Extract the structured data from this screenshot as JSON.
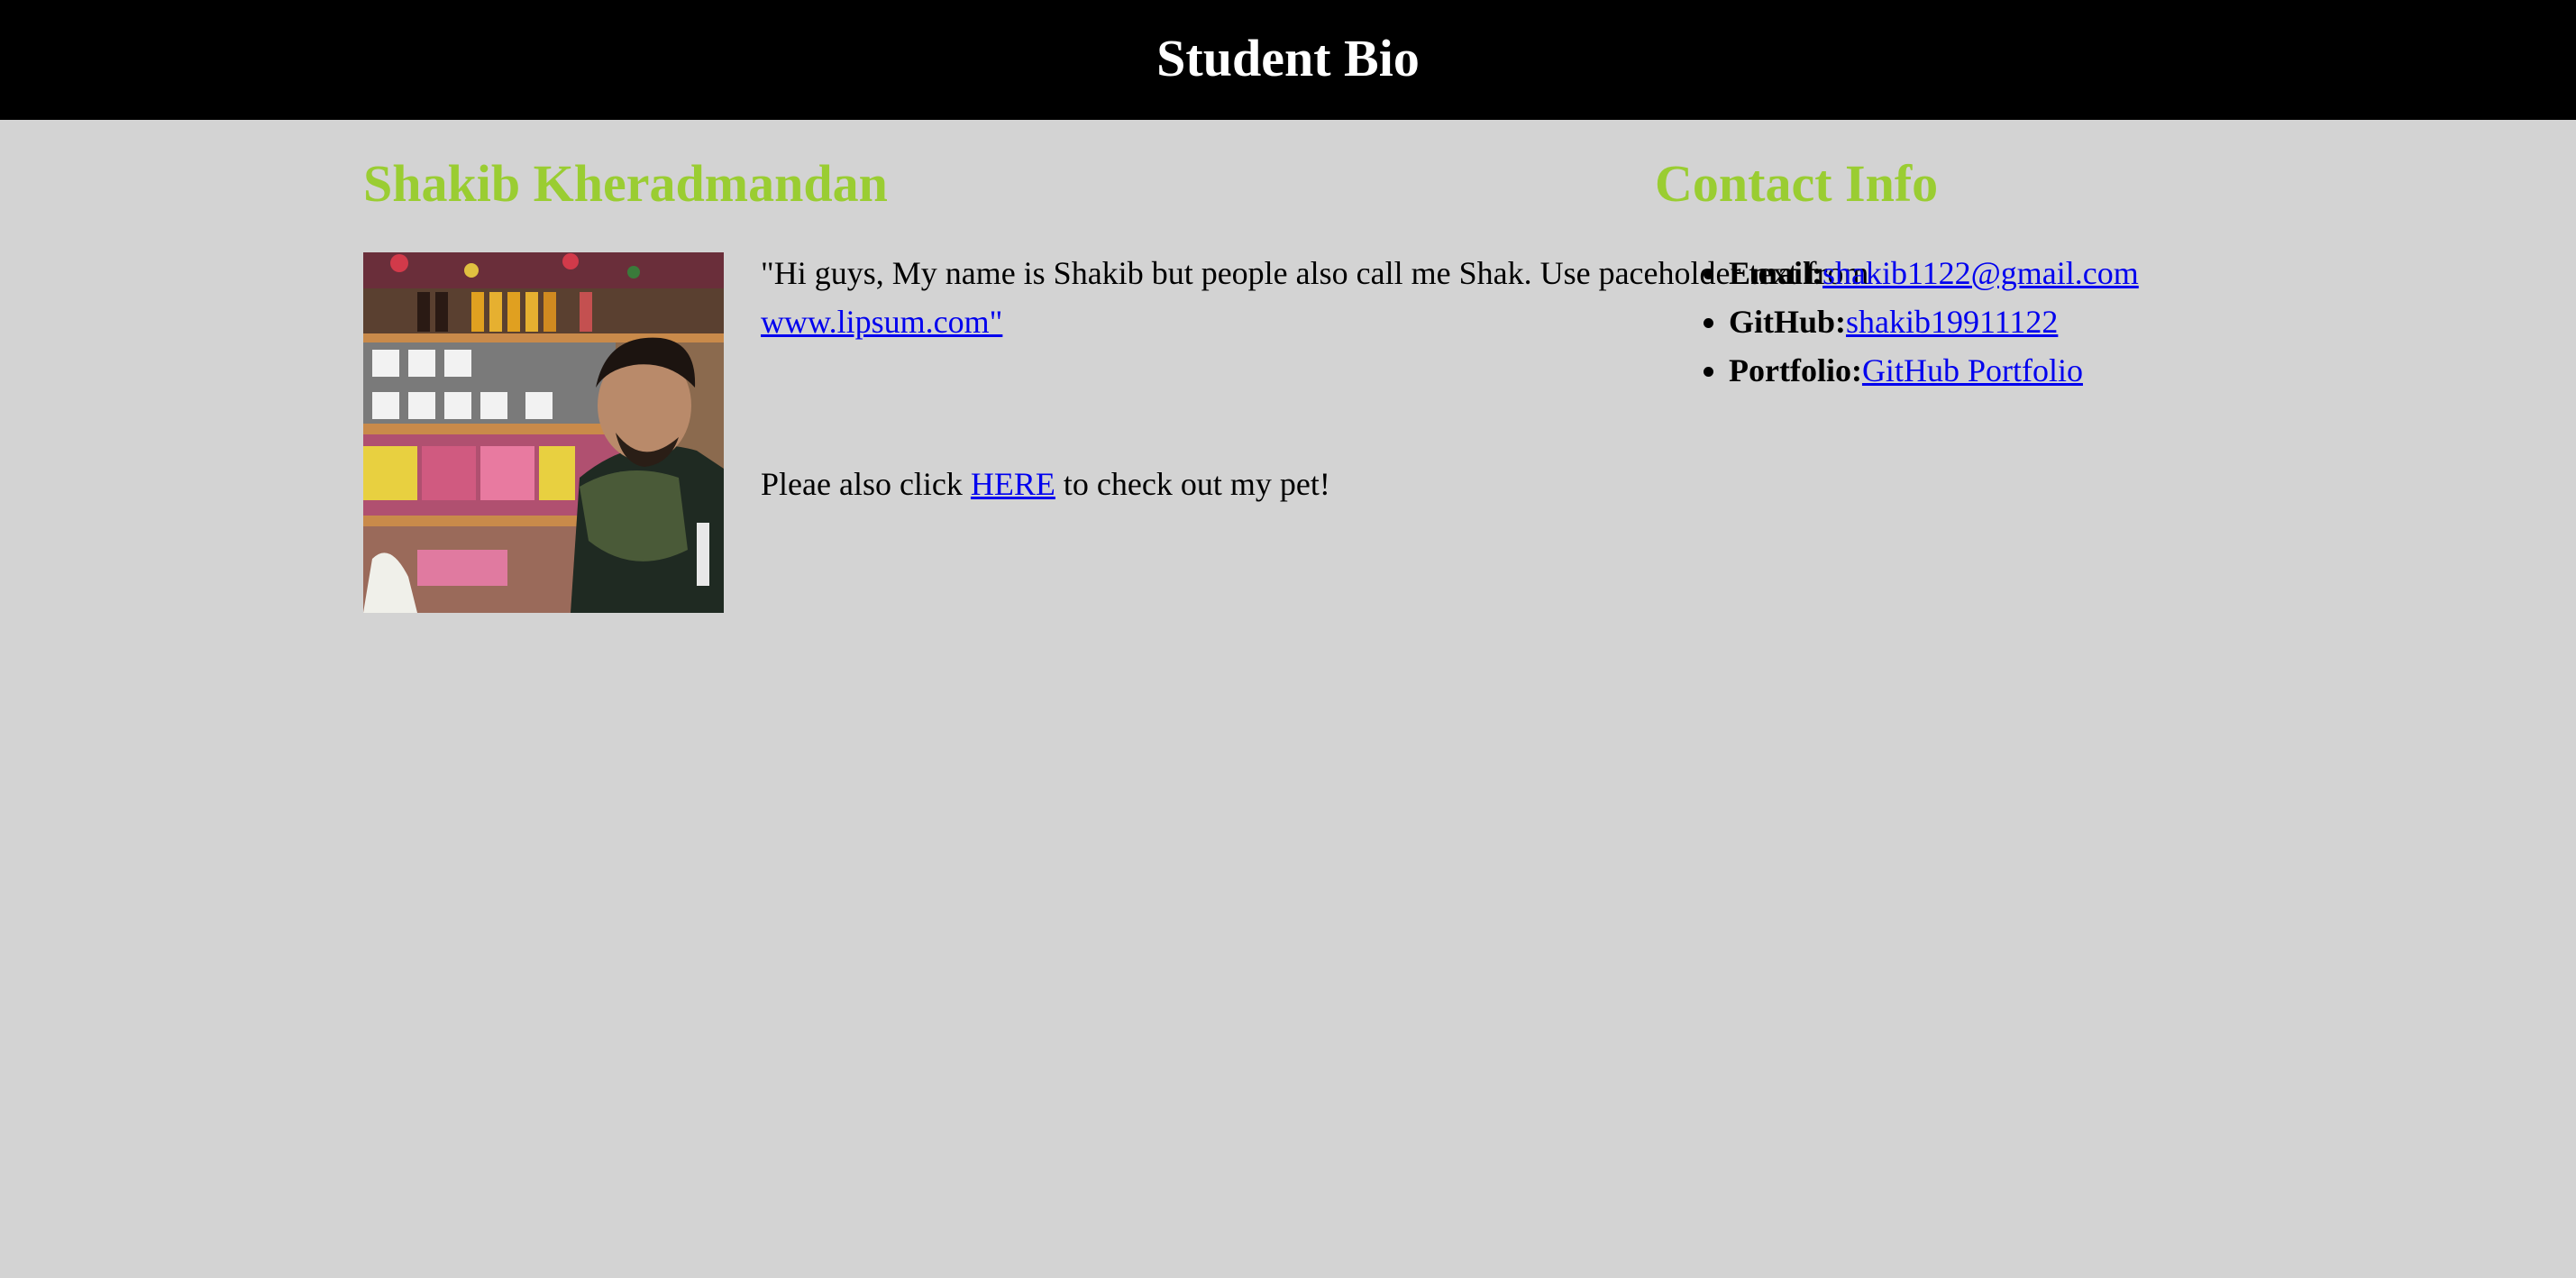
{
  "header": {
    "title": "Student Bio"
  },
  "bio": {
    "name": "Shakib Kheradmandan",
    "intro_before_link": "\"Hi guys, My name is Shakib but people also call me Shak. Use paceholder text from ",
    "intro_link": "www.lipsum.com\"",
    "pet_before": "Pleae also click ",
    "pet_link": "HERE",
    "pet_after": " to check out my pet!"
  },
  "contact": {
    "title": "Contact Info",
    "items": [
      {
        "label": "Email:",
        "value": "shakib1122@gmail.com"
      },
      {
        "label": "GitHub:",
        "value": "shakib19911122"
      },
      {
        "label": "Portfolio:",
        "value": "GitHub Portfolio"
      }
    ]
  }
}
